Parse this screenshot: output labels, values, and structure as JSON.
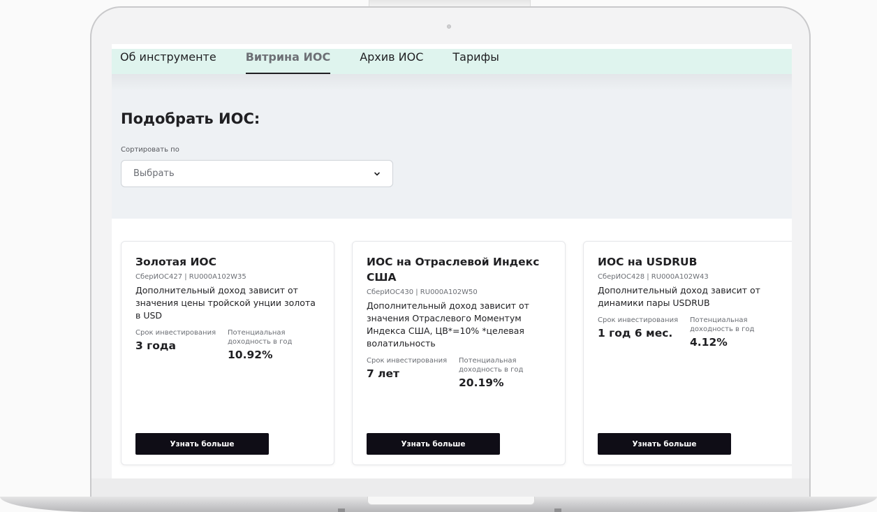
{
  "tabs": [
    {
      "label": "Об инструменте",
      "active": false
    },
    {
      "label": "Витрина ИОС",
      "active": true
    },
    {
      "label": "Архив ИОС",
      "active": false
    },
    {
      "label": "Тарифы",
      "active": false
    }
  ],
  "filter": {
    "title": "Подобрать ИОС:",
    "sort_label": "Сортировать по",
    "sort_value": "Выбрать"
  },
  "cards": [
    {
      "title": "Золотая ИОС",
      "code": "СберИОС427 | RU000A102W35",
      "description": "Дополнительный доход зависит от значения цены тройской унции золота в USD",
      "term_label": "Срок инвестирования",
      "term_value": "3 года",
      "yield_label": "Потенциальная доходность в год",
      "yield_value": "10.92%",
      "button": "Узнать больше"
    },
    {
      "title": "ИОС на Отраслевой Индекс США",
      "code": "СберИОС430 | RU000A102W50",
      "description": "Дополнительный доход зависит от значения Отраслевого Моментум Индекса США, ЦВ*=10% *целевая волатильность",
      "term_label": "Срок инвестирования",
      "term_value": "7 лет",
      "yield_label": "Потенциальная доходность в год",
      "yield_value": "20.19%",
      "button": "Узнать больше"
    },
    {
      "title": "ИОС на USDRUB",
      "code": "СберИОС428 | RU000A102W43",
      "description": "Дополнительный доход зависит от динамики пары USDRUB",
      "term_label": "Срок инвестирования",
      "term_value": "1 год 6 мес.",
      "yield_label": "Потенциальная доходность в год",
      "yield_value": "4.12%",
      "button": "Узнать больше"
    }
  ],
  "colors": {
    "tabs_bg": "#dff4ee",
    "filter_bg": "#eef1f4",
    "button_bg": "#0f0d16"
  }
}
